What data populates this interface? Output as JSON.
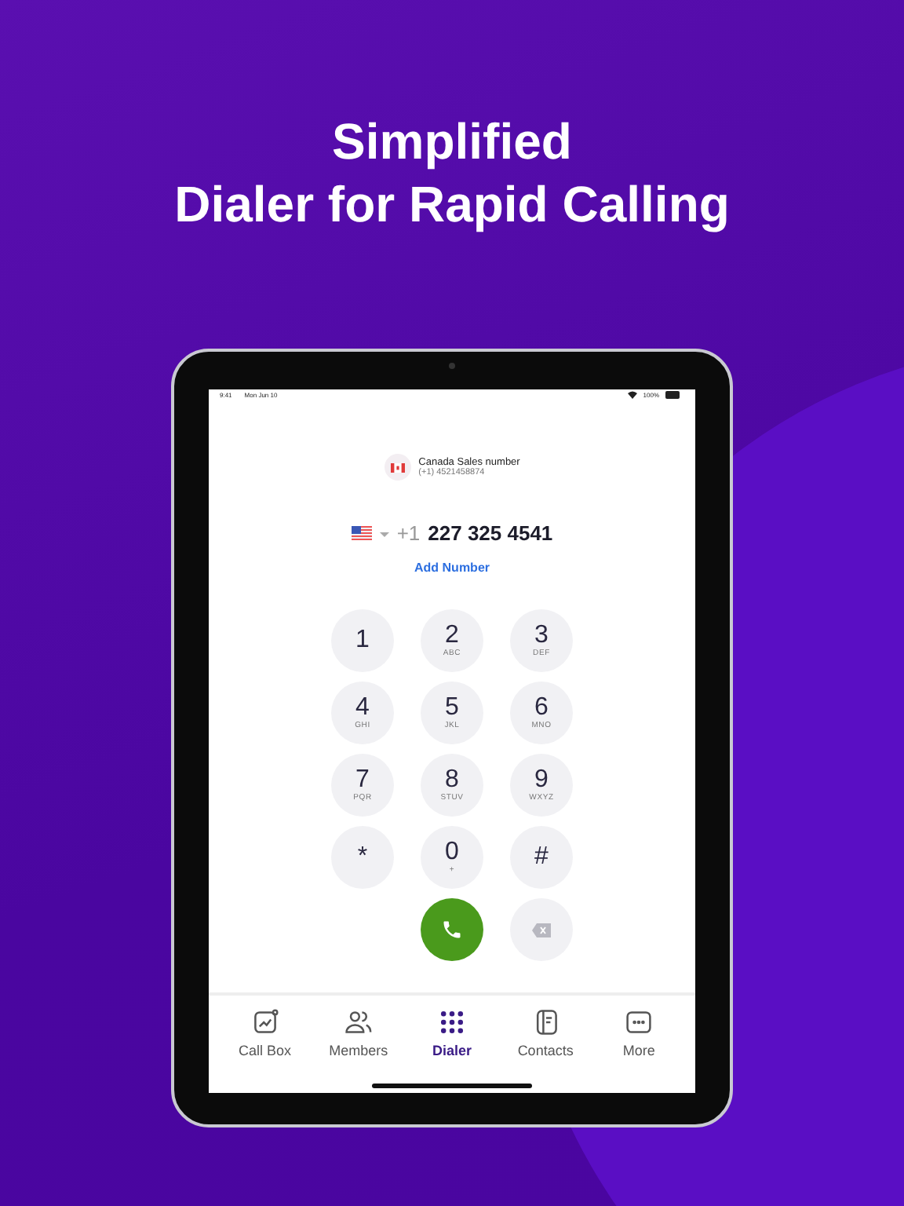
{
  "headline": [
    "Simplified",
    "Dialer for Rapid Calling"
  ],
  "status_bar": {
    "time": "9:41",
    "date": "Mon Jun 10",
    "battery": "100%"
  },
  "caller_id": {
    "name": "Canada Sales number",
    "number": "(+1) 4521458874"
  },
  "number_entry": {
    "prefix": "+1",
    "value": "227 325 4541"
  },
  "add_number": "Add Number",
  "keypad": [
    {
      "digit": "1"
    },
    {
      "digit": "2",
      "letters": "ABC"
    },
    {
      "digit": "3",
      "letters": "DEF"
    },
    {
      "digit": "4",
      "letters": "GHI"
    },
    {
      "digit": "5",
      "letters": "JKL"
    },
    {
      "digit": "6",
      "letters": "MNO"
    },
    {
      "digit": "7",
      "letters": "PQR"
    },
    {
      "digit": "8",
      "letters": "STUV"
    },
    {
      "digit": "9",
      "letters": "WXYZ"
    },
    {
      "digit": "*"
    },
    {
      "digit": "0",
      "letters": "+"
    },
    {
      "digit": "#"
    }
  ],
  "tabs": [
    {
      "label": "Call Box",
      "selected": false
    },
    {
      "label": "Members",
      "selected": false
    },
    {
      "label": "Dialer",
      "selected": true
    },
    {
      "label": "Contacts",
      "selected": false
    },
    {
      "label": "More",
      "selected": false
    }
  ]
}
